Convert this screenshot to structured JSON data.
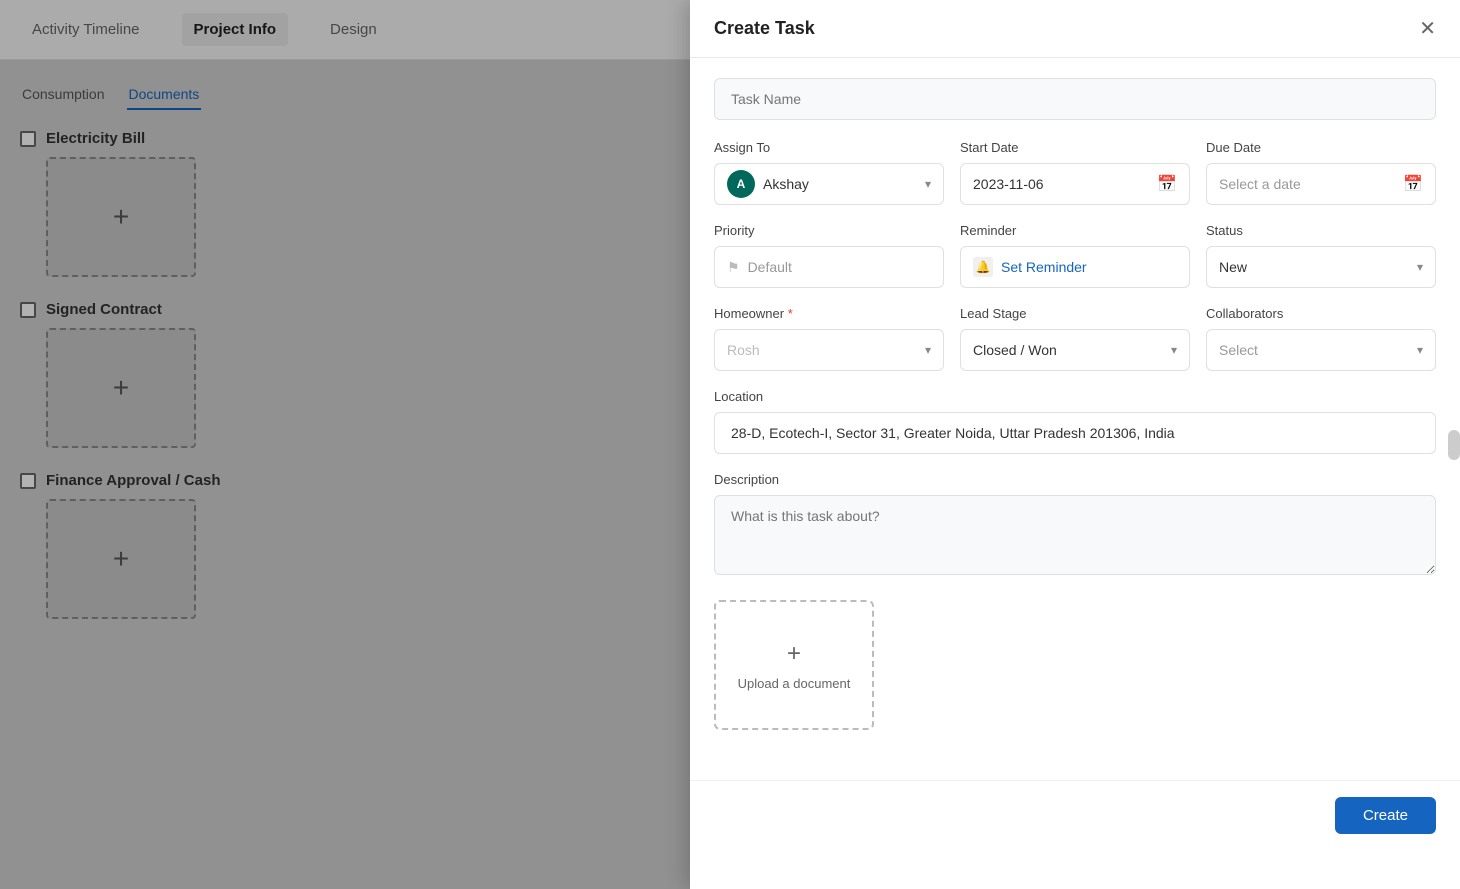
{
  "background": {
    "tabs": [
      {
        "id": "activity",
        "label": "Activity Timeline",
        "active": false
      },
      {
        "id": "project",
        "label": "Project Info",
        "active": true
      },
      {
        "id": "design",
        "label": "Design",
        "active": false
      }
    ],
    "sub_tabs": [
      {
        "id": "consumption",
        "label": "Consumption",
        "active": false
      },
      {
        "id": "documents",
        "label": "Documents",
        "active": true
      }
    ],
    "documents": [
      {
        "id": "electricity",
        "label": "Electricity Bill",
        "checked": false
      },
      {
        "id": "signed",
        "label": "Signed Contract",
        "checked": false
      },
      {
        "id": "finance",
        "label": "Finance Approval / Cash",
        "checked": false
      }
    ]
  },
  "modal": {
    "title": "Create Task",
    "task_name_placeholder": "Task Name",
    "assign_to_label": "Assign To",
    "assignee": "Akshay",
    "assignee_initial": "A",
    "start_date_label": "Start Date",
    "start_date_value": "2023-11-06",
    "due_date_label": "Due Date",
    "due_date_placeholder": "Select a date",
    "priority_label": "Priority",
    "priority_default": "Default",
    "reminder_label": "Reminder",
    "reminder_text": "Set Reminder",
    "status_label": "Status",
    "status_value": "New",
    "homeowner_label": "Homeowner",
    "homeowner_required": true,
    "homeowner_placeholder": "Rosh",
    "lead_stage_label": "Lead Stage",
    "lead_stage_value": "Closed / Won",
    "collaborators_label": "Collaborators",
    "collaborators_placeholder": "Select",
    "location_label": "Location",
    "location_value": "28-D, Ecotech-I, Sector 31, Greater Noida, Uttar Pradesh 201306, India",
    "description_label": "Description",
    "description_placeholder": "What is this task about?",
    "upload_label": "Upload a document",
    "create_button": "Create"
  }
}
